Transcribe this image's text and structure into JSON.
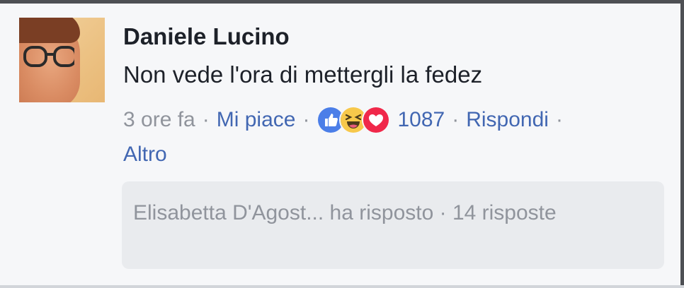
{
  "comment": {
    "author": "Daniele Lucino",
    "text": "Non vede l'ora di mettergli la fedez",
    "time": "3 ore fa",
    "separator": "·",
    "like_label": "Mi piace",
    "reactions": [
      "like-icon",
      "haha-icon",
      "love-icon"
    ],
    "reaction_count": "1087",
    "reply_label": "Rispondi",
    "more_label": "Altro"
  },
  "replies": {
    "summary": "Elisabetta D'Agost... ha risposto · 14 risposte"
  },
  "colors": {
    "link": "#4267b2",
    "meta_gray": "#90949c",
    "text": "#1d2129",
    "like_blue": "#4267b2",
    "haha_yellow": "#f7c84b",
    "love_red": "#f0284a"
  }
}
